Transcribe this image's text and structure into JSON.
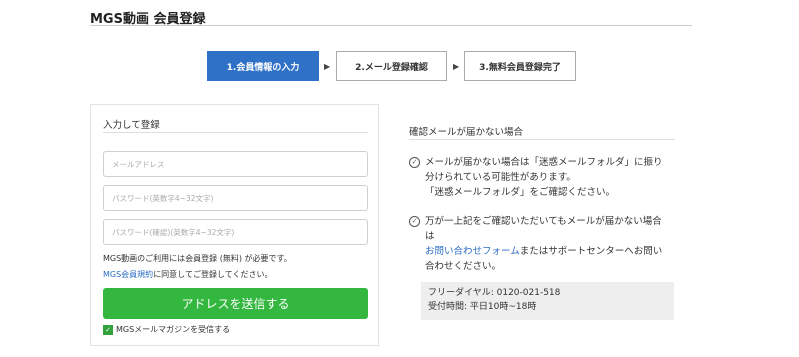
{
  "header": {
    "title": "MGS動画 会員登録"
  },
  "steps": [
    {
      "label": "1.会員情報の入力",
      "active": true
    },
    {
      "label": "2.メール登録確認",
      "active": false
    },
    {
      "label": "3.無料会員登録完了",
      "active": false
    }
  ],
  "step_arrow": "▶",
  "form": {
    "heading": "入力して登録",
    "email_placeholder": "メールアドレス",
    "password_placeholder": "パスワード(英数字4~32文字)",
    "password_confirm_placeholder": "パスワード(確認)(英数字4~32文字)",
    "notice_line1": "MGS動画のご利用には会員登録 (無料) が必要です。",
    "terms_link": "MGS会員規約",
    "notice_line2_rest": "に同意してご登録してください。",
    "submit_label": "アドレスを送信する",
    "newsletter_label": "MGSメールマガジンを受信する",
    "newsletter_checked": true
  },
  "help": {
    "heading": "確認メールが届かない場合",
    "item1_lines": [
      "メールが届かない場合は「迷惑メールフォルダ」に振り",
      "分けられている可能性があります。",
      "「迷惑メールフォルダ」をご確認ください。"
    ],
    "item2_line1": "万が一上記をご確認いただいてもメールが届かない場合",
    "item2_line2": "は",
    "contact_link": "お問い合わせフォーム",
    "item2_line3_rest": "またはサポートセンターへお問い",
    "item2_line4": "合わせください。",
    "phone": "フリーダイヤル: 0120-021-518",
    "hours": "受付時間: 平日10時~18時"
  },
  "colors": {
    "accent": "#2f71c6",
    "submit": "#33b73f",
    "link": "#2b6cc4"
  }
}
